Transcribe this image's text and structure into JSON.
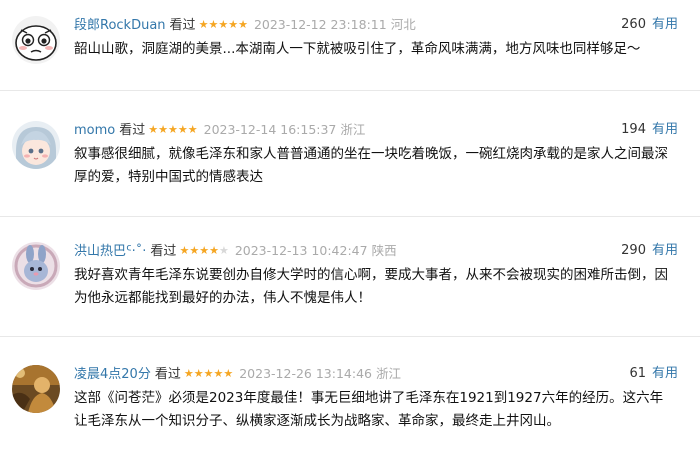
{
  "comments": [
    {
      "user": "段郎RockDuan",
      "rating_label": "看过",
      "stars": 5,
      "time": "2023-12-12 23:18:11",
      "location": "河北",
      "votes": "260",
      "useful_label": "有用",
      "content": "韶山山歌，洞庭湖的美景...本湖南人一下就被吸引住了，革命风味满满，地方风味也同样够足～",
      "avatar_icon": "cartoon-face-avatar"
    },
    {
      "user": "momo",
      "rating_label": "看过",
      "stars": 5,
      "time": "2023-12-14 16:15:37",
      "location": "浙江",
      "votes": "194",
      "useful_label": "有用",
      "content": "叙事感很细腻，就像毛泽东和家人普普通通的坐在一块吃着晚饭，一碗红烧肉承载的是家人之间最深厚的爱，特别中国式的情感表达",
      "avatar_icon": "anime-girl-avatar"
    },
    {
      "user": "洪山热巴ᑦ·˚·",
      "rating_label": "看过",
      "stars": 4,
      "time": "2023-12-13 10:42:47",
      "location": "陕西",
      "votes": "290",
      "useful_label": "有用",
      "content": "我好喜欢青年毛泽东说要创办自修大学时的信心啊，要成大事者，从来不会被现实的困难所击倒，因为他永远都能找到最好的办法，伟人不愧是伟人！",
      "avatar_icon": "plush-bunny-avatar"
    },
    {
      "user": "凌晨4点20分",
      "rating_label": "看过",
      "stars": 5,
      "time": "2023-12-26 13:14:46",
      "location": "浙江",
      "votes": "61",
      "useful_label": "有用",
      "content": "这部《问苍茫》必须是2023年度最佳！事无巨细地讲了毛泽东在1921到1927六年的经历。这六年让毛泽东从一个知识分子、纵横家逐渐成长为战略家、革命家，最终走上井冈山。",
      "avatar_icon": "golden-figure-avatar"
    }
  ],
  "colors": {
    "link": "#3377aa",
    "star": "#f5a623",
    "meta_gray": "#aaaaaa"
  }
}
